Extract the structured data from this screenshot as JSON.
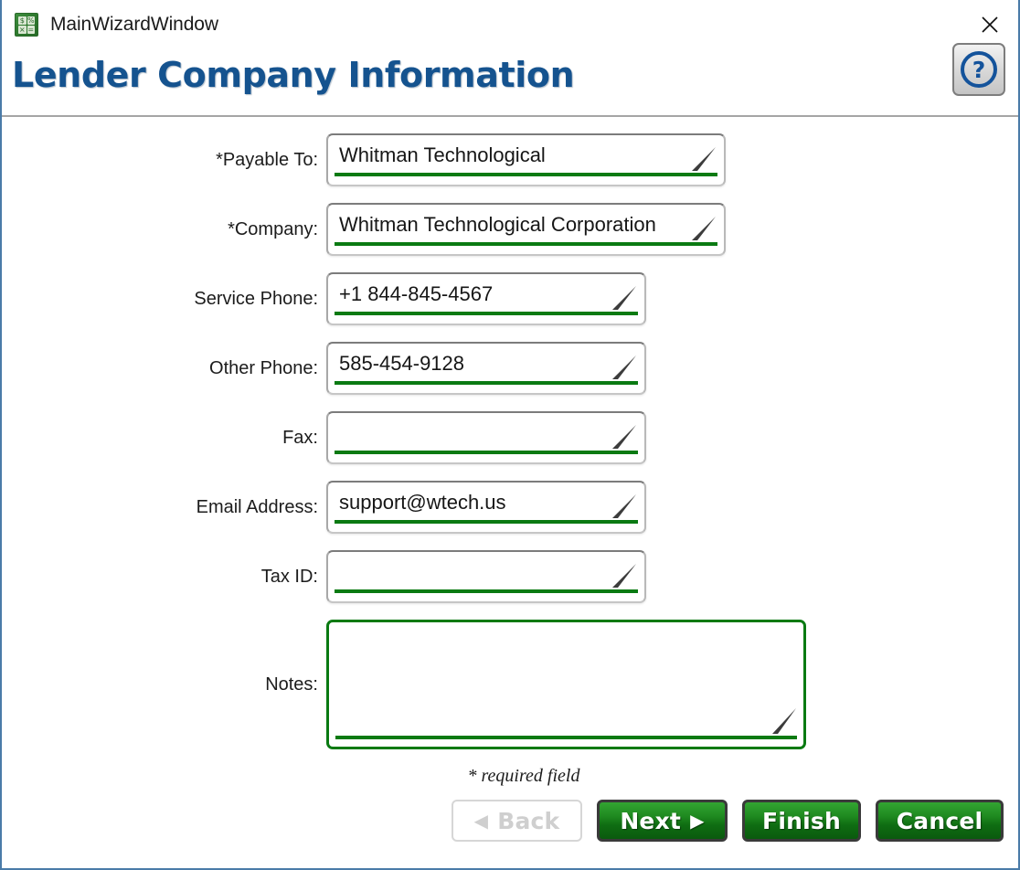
{
  "window": {
    "titlebar_text": "MainWizardWindow",
    "app_icon": "calculator-icon",
    "icon_glyphs": [
      "$",
      "%",
      "×",
      "="
    ],
    "close_icon": "close-icon",
    "accent_blue": "#15538f",
    "accent_green": "#0a7a12",
    "border_color": "#4a7ba8"
  },
  "header": {
    "page_title": "Lender Company Information",
    "help_button": {
      "icon": "help-question-icon",
      "glyph": "?"
    }
  },
  "form": {
    "fields": [
      {
        "label": "*Payable To:",
        "value": "Whitman Technological",
        "name": "payable-to",
        "required": true,
        "width": "wide"
      },
      {
        "label": "*Company:",
        "value": "Whitman Technological Corporation",
        "name": "company",
        "required": true,
        "width": "wide"
      },
      {
        "label": "Service Phone:",
        "value": "+1 844-845-4567",
        "name": "service-phone",
        "required": false,
        "width": "med"
      },
      {
        "label": "Other Phone:",
        "value": "585-454-9128",
        "name": "other-phone",
        "required": false,
        "width": "med"
      },
      {
        "label": "Fax:",
        "value": "",
        "name": "fax",
        "required": false,
        "width": "med"
      },
      {
        "label": "Email Address:",
        "value": "support@wtech.us",
        "name": "email-address",
        "required": false,
        "width": "med"
      },
      {
        "label": "Tax ID:",
        "value": "",
        "name": "tax-id",
        "required": false,
        "width": "med"
      }
    ],
    "notes": {
      "label": "Notes:",
      "value": "",
      "focused": true
    },
    "required_note": "* required field"
  },
  "footer": {
    "buttons": [
      {
        "label": "Back",
        "name": "back-button",
        "state": "disabled",
        "arrow": "◀",
        "arrow_side": "left"
      },
      {
        "label": "Next",
        "name": "next-button",
        "state": "enabled",
        "arrow": "▶",
        "arrow_side": "right"
      },
      {
        "label": "Finish",
        "name": "finish-button",
        "state": "enabled",
        "arrow": "",
        "arrow_side": "none"
      },
      {
        "label": "Cancel",
        "name": "cancel-button",
        "state": "enabled",
        "arrow": "",
        "arrow_side": "none"
      }
    ]
  }
}
